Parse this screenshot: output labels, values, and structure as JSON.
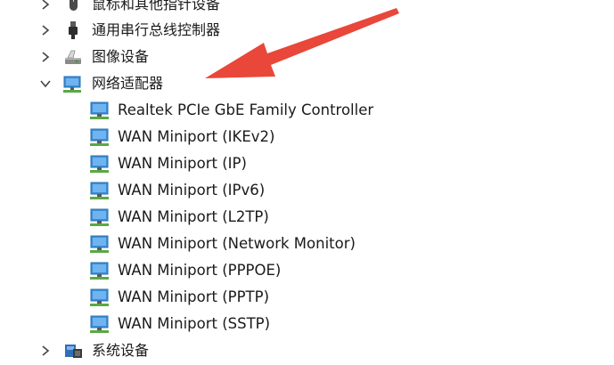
{
  "tree": {
    "categories": [
      {
        "label": "鼠标和其他指针设备",
        "icon": "mouse-icon",
        "expanded": false
      },
      {
        "label": "通用串行总线控制器",
        "icon": "usb-icon",
        "expanded": false
      },
      {
        "label": "图像设备",
        "icon": "camera-icon",
        "expanded": false
      },
      {
        "label": "网络适配器",
        "icon": "network-adapter-icon",
        "expanded": true
      },
      {
        "label": "系统设备",
        "icon": "system-device-icon",
        "expanded": false
      }
    ],
    "network_adapters": [
      "Realtek PCIe GbE Family Controller",
      "WAN Miniport (IKEv2)",
      "WAN Miniport (IP)",
      "WAN Miniport (IPv6)",
      "WAN Miniport (L2TP)",
      "WAN Miniport (Network Monitor)",
      "WAN Miniport (PPPOE)",
      "WAN Miniport (PPTP)",
      "WAN Miniport (SSTP)"
    ]
  },
  "annotation": {
    "arrow_color": "#e8473a",
    "arrow_target": "网络适配器"
  },
  "colors": {
    "text": "#1a1a1a",
    "adapter_icon_screen": "#3b8fd9",
    "adapter_icon_green": "#5aa845"
  }
}
